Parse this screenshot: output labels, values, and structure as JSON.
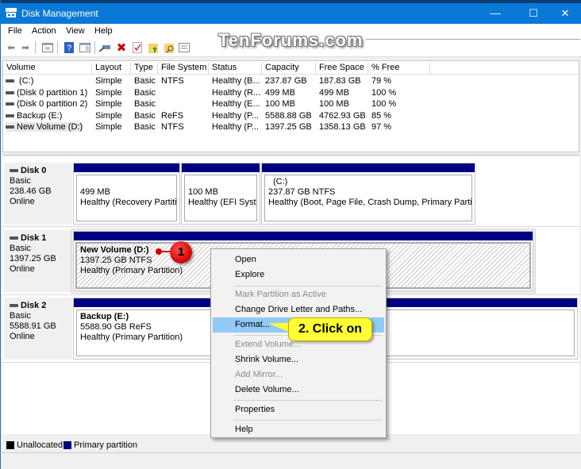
{
  "window": {
    "title": "Disk Management",
    "controls": {
      "minimize": "—",
      "maximize": "☐",
      "close": "✕"
    }
  },
  "watermark": "TenForums.com",
  "menu": [
    "File",
    "Action",
    "View",
    "Help"
  ],
  "toolbar": {
    "icons": [
      "back-icon",
      "forward-icon",
      "show-hide-console-tree-icon",
      "help-icon",
      "show-hide-action-pane-icon",
      "connect-drive-icon",
      "delete-icon",
      "properties-check-icon",
      "folder-up-icon",
      "folder-search-icon",
      "settings-list-icon"
    ]
  },
  "volume_list": {
    "columns": [
      "Volume",
      "Layout",
      "Type",
      "File System",
      "Status",
      "Capacity",
      "Free Space",
      "% Free"
    ],
    "rows": [
      {
        "volume": " (C:)",
        "layout": "Simple",
        "type": "Basic",
        "fs": "NTFS",
        "status": "Healthy (B...",
        "capacity": "237.87 GB",
        "free": "187.83 GB",
        "pct": "79 %"
      },
      {
        "volume": "(Disk 0 partition 1)",
        "layout": "Simple",
        "type": "Basic",
        "fs": "",
        "status": "Healthy (R...",
        "capacity": "499 MB",
        "free": "499 MB",
        "pct": "100 %"
      },
      {
        "volume": "(Disk 0 partition 2)",
        "layout": "Simple",
        "type": "Basic",
        "fs": "",
        "status": "Healthy (E...",
        "capacity": "100 MB",
        "free": "100 MB",
        "pct": "100 %"
      },
      {
        "volume": "Backup (E:)",
        "layout": "Simple",
        "type": "Basic",
        "fs": "ReFS",
        "status": "Healthy (P...",
        "capacity": "5588.88 GB",
        "free": "4762.93 GB",
        "pct": "85 %"
      },
      {
        "volume": "New Volume (D:)",
        "layout": "Simple",
        "type": "Basic",
        "fs": "NTFS",
        "status": "Healthy (P...",
        "capacity": "1397.25 GB",
        "free": "1358.13 GB",
        "pct": "97 %"
      }
    ]
  },
  "disks": [
    {
      "name": "Disk 0",
      "type": "Basic",
      "size": "238.46 GB",
      "state": "Online",
      "partitions": [
        {
          "name": "",
          "size": "499 MB",
          "status": "Healthy (Recovery Partition)"
        },
        {
          "name": "",
          "size": "100 MB",
          "status": "Healthy (EFI System Partition)"
        },
        {
          "name": "(C:)",
          "size": "237.87 GB NTFS",
          "status": "Healthy (Boot, Page File, Crash Dump, Primary Partition)"
        }
      ]
    },
    {
      "name": "Disk 1",
      "type": "Basic",
      "size": "1397.25 GB",
      "state": "Online",
      "partitions": [
        {
          "name": "New Volume  (D:)",
          "size": "1397.25 GB NTFS",
          "status": "Healthy (Primary Partition)",
          "selected": true
        }
      ]
    },
    {
      "name": "Disk 2",
      "type": "Basic",
      "size": "5588.91 GB",
      "state": "Online",
      "partitions": [
        {
          "name": "Backup  (E:)",
          "size": "5588.90 GB ReFS",
          "status": "Healthy (Primary Partition)"
        }
      ]
    }
  ],
  "legend": [
    {
      "label": "Unallocated",
      "color": "#000000"
    },
    {
      "label": "Primary partition",
      "color": "#000080"
    }
  ],
  "context_menu": {
    "items": [
      {
        "label": "Open",
        "enabled": true
      },
      {
        "label": "Explore",
        "enabled": true
      },
      {
        "label": "Mark Partition as Active",
        "enabled": false
      },
      {
        "label": "Change Drive Letter and Paths...",
        "enabled": true
      },
      {
        "label": "Format...",
        "enabled": true,
        "highlighted": true
      },
      {
        "label": "Extend Volume...",
        "enabled": false
      },
      {
        "label": "Shrink Volume...",
        "enabled": true
      },
      {
        "label": "Add Mirror...",
        "enabled": false
      },
      {
        "label": "Delete Volume...",
        "enabled": true
      },
      {
        "label": "Properties",
        "enabled": true
      },
      {
        "label": "Help",
        "enabled": true
      }
    ]
  },
  "annotations": {
    "step1": "1",
    "step2": "2. Click on"
  },
  "colors": {
    "titlebar": "#0a78d7",
    "primary_partition": "#000080",
    "menu_highlight": "#91c9f7",
    "callout": "#ffff33",
    "step_badge": "#d00000"
  }
}
